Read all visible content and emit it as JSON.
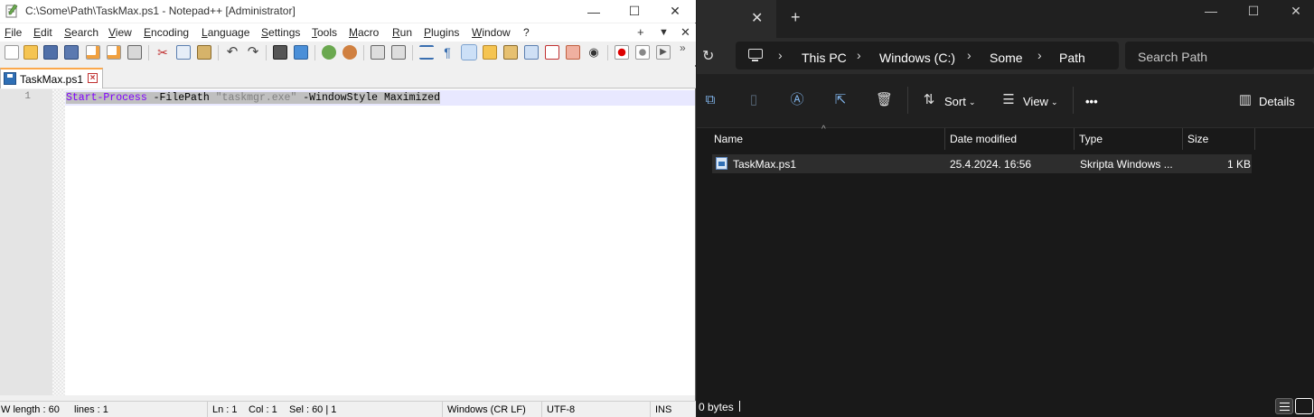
{
  "notepad": {
    "title": "C:\\Some\\Path\\TaskMax.ps1 - Notepad++ [Administrator]",
    "menu": [
      "File",
      "Edit",
      "Search",
      "View",
      "Encoding",
      "Language",
      "Settings",
      "Tools",
      "Macro",
      "Run",
      "Plugins",
      "Window",
      "?"
    ],
    "menu_right": [
      "+",
      "▼",
      "✕"
    ],
    "tab_label": "TaskMax.ps1",
    "line_number": "1",
    "code": {
      "cmdlet": "Start-Process",
      "param1": " -FilePath ",
      "string": "\"taskmgr.exe\"",
      "param2": " -WindowStyle Maximized"
    },
    "status": {
      "length": "W length : 60",
      "lines": "lines : 1",
      "ln": "Ln : 1",
      "col": "Col : 1",
      "sel": "Sel : 60 | 1",
      "eol": "Windows (CR LF)",
      "encoding": "UTF-8",
      "mode": "INS"
    }
  },
  "explorer": {
    "breadcrumbs": [
      "This PC",
      "Windows (C:)",
      "Some",
      "Path"
    ],
    "search_placeholder": "Search Path",
    "commands": {
      "sort": "Sort",
      "view": "View",
      "more": "•••",
      "details": "Details"
    },
    "columns": [
      "Name",
      "Date modified",
      "Type",
      "Size"
    ],
    "files": [
      {
        "name": "TaskMax.ps1",
        "date": "25.4.2024. 16:56",
        "type": "Skripta Windows ...",
        "size": "1 KB"
      }
    ],
    "status": "0 bytes"
  },
  "colors": {
    "cmdlet": "#8000ff",
    "string": "#808080",
    "explorer_bg": "#191919",
    "accent": "#7fb2e8"
  }
}
